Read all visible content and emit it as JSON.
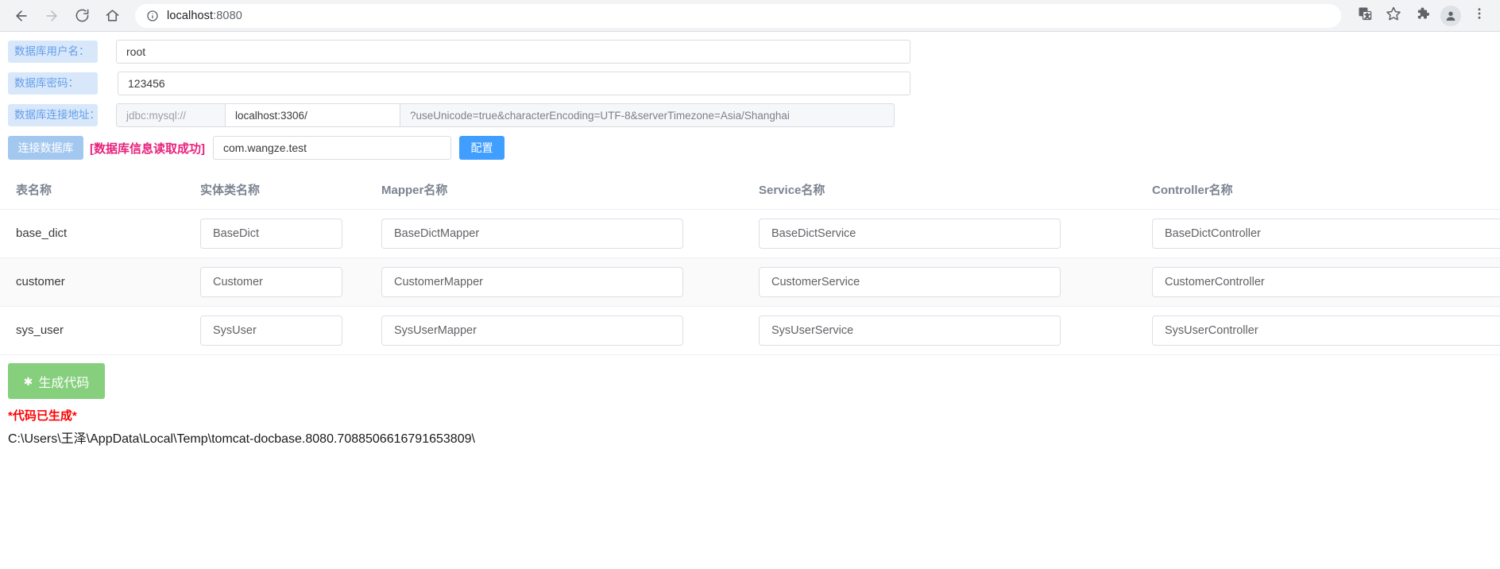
{
  "browser": {
    "back_label": "back-arrow",
    "forward_label": "forward-arrow",
    "reload_label": "reload",
    "home_label": "home",
    "url_host": "localhost",
    "url_port": ":8080",
    "site_info_icon": "info-circle-icon",
    "translate_icon": "translate-icon",
    "bookmark_icon": "star-icon",
    "extensions_icon": "puzzle-icon",
    "profile_icon": "avatar-icon",
    "menu_icon": "three-dots-icon"
  },
  "form": {
    "username": {
      "label": "数据库用户名：",
      "value": "root",
      "placeholder": ""
    },
    "password": {
      "label": "数据库密码：",
      "value": "123456",
      "placeholder": ""
    },
    "address": {
      "label": "数据库连接地址：",
      "prefix": "jdbc:mysql://",
      "hostport": "localhost:3306/",
      "params": "?useUnicode=true&characterEncoding=UTF-8&serverTimezone=Asia/Shanghai"
    }
  },
  "actions": {
    "connect_label": "连接数据库",
    "status_text": "[数据库信息读取成功]",
    "package_value": "com.wangze.test",
    "package_placeholder": "",
    "config_label": "配置"
  },
  "table": {
    "headers": [
      "表名称",
      "实体类名称",
      "Mapper名称",
      "Service名称",
      "Controller名称"
    ],
    "rows": [
      {
        "table_name": "base_dict",
        "entity": "BaseDict",
        "mapper": "BaseDictMapper",
        "service": "BaseDictService",
        "controller": "BaseDictController"
      },
      {
        "table_name": "customer",
        "entity": "Customer",
        "mapper": "CustomerMapper",
        "service": "CustomerService",
        "controller": "CustomerController"
      },
      {
        "table_name": "sys_user",
        "entity": "SysUser",
        "mapper": "SysUserMapper",
        "service": "SysUserService",
        "controller": "SysUserController"
      }
    ]
  },
  "footer": {
    "generate_icon": "sparkle-icon",
    "generate_label": "生成代码",
    "done_message": "*代码已生成*",
    "output_path": "C:\\Users\\王泽\\AppData\\Local\\Temp\\tomcat-docbase.8080.7088506616791653809\\"
  },
  "colors": {
    "label_bg": "#d9e7fb",
    "label_fg": "#62a0e8",
    "connect_btn": "#a3c8f0",
    "config_btn": "#409eff",
    "status_fg": "#e8227c",
    "generate_btn": "#85cf7d",
    "done_fg": "#ff0000"
  }
}
